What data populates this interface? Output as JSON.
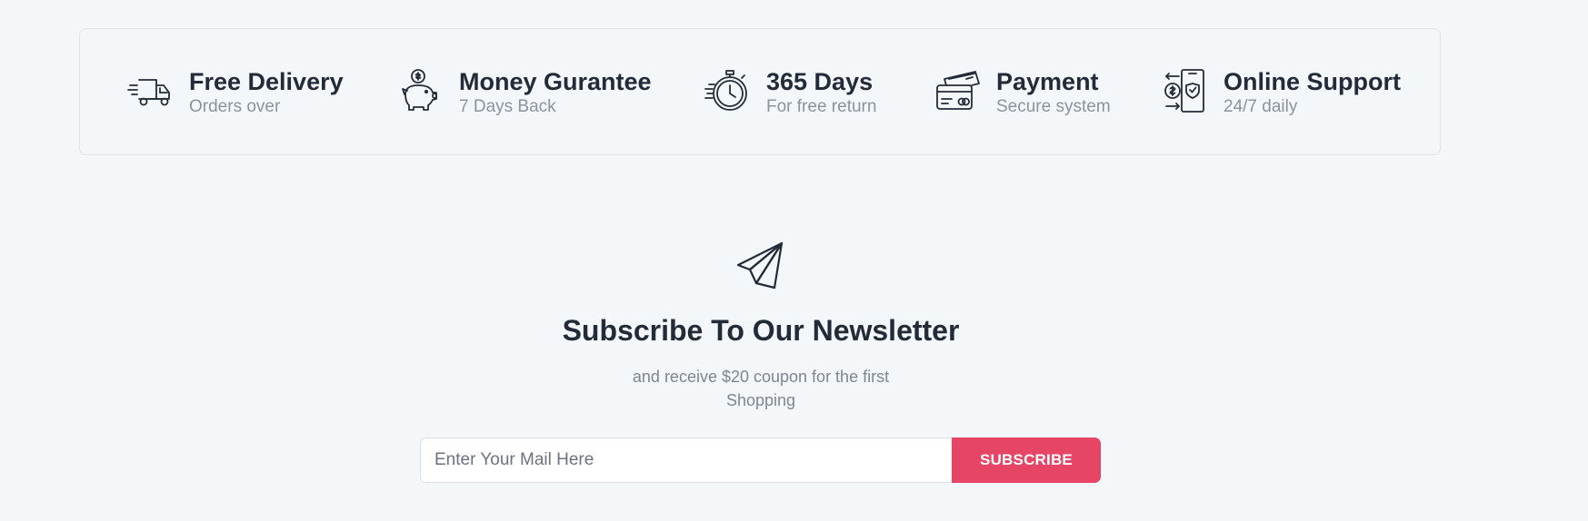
{
  "features": [
    {
      "title": "Free Delivery",
      "subtitle": "Orders over",
      "icon": "delivery-truck-icon"
    },
    {
      "title": "Money Gurantee",
      "subtitle": "7 Days Back",
      "icon": "piggy-bank-icon"
    },
    {
      "title": "365 Days",
      "subtitle": "For free return",
      "icon": "stopwatch-icon"
    },
    {
      "title": "Payment",
      "subtitle": "Secure system",
      "icon": "credit-card-icon"
    },
    {
      "title": "Online Support",
      "subtitle": "24/7 daily",
      "icon": "mobile-support-icon"
    }
  ],
  "newsletter": {
    "icon": "paper-plane-icon",
    "title": "Subscribe To Our Newsletter",
    "text": "and receive $20 coupon for the first Shopping",
    "input_placeholder": "Enter Your Mail Here",
    "input_value": "",
    "button_label": "SUBSCRIBE"
  },
  "colors": {
    "background": "#f4f7fa",
    "text_dark": "#232b38",
    "text_muted": "#8a939e",
    "accent": "#e64565"
  }
}
